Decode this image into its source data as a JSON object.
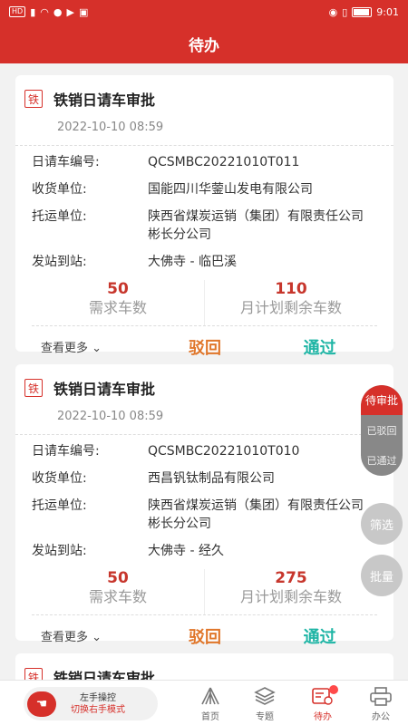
{
  "status": {
    "carrier": "HD",
    "time": "9:01"
  },
  "header": {
    "title": "待办"
  },
  "cards": [
    {
      "badge": "铁",
      "title": "铁销日请车审批",
      "date": "2022-10-10 08:59",
      "fields": [
        {
          "key": "日请车编号:",
          "value": "QCSMBC20221010T011"
        },
        {
          "key": "收货单位:",
          "value": "国能四川华蓥山发电有限公司"
        },
        {
          "key": "托运单位:",
          "value": "陕西省煤炭运销（集团）有限责任公司彬长分公司"
        },
        {
          "key": "发站到站:",
          "value": "大佛寺 - 临巴溪"
        }
      ],
      "demand_num": "50",
      "demand_label": "需求车数",
      "remain_num": "110",
      "remain_label": "月计划剩余车数",
      "more": "查看更多",
      "reject": "驳回",
      "pass": "通过"
    },
    {
      "badge": "铁",
      "title": "铁销日请车审批",
      "date": "2022-10-10 08:59",
      "fields": [
        {
          "key": "日请车编号:",
          "value": "QCSMBC20221010T010"
        },
        {
          "key": "收货单位:",
          "value": "西昌钒钛制品有限公司"
        },
        {
          "key": "托运单位:",
          "value": "陕西省煤炭运销（集团）有限责任公司彬长分公司"
        },
        {
          "key": "发站到站:",
          "value": "大佛寺 - 经久"
        }
      ],
      "demand_num": "50",
      "demand_label": "需求车数",
      "remain_num": "275",
      "remain_label": "月计划剩余车数",
      "more": "查看更多",
      "reject": "驳回",
      "pass": "通过"
    },
    {
      "badge": "铁",
      "title": "铁销日请车审批"
    }
  ],
  "float_tabs": [
    "待审批",
    "已驳回",
    "已通过"
  ],
  "filter_label": "筛选",
  "batch_label": "批量",
  "hand_mode": {
    "title": "左手操控",
    "subtitle": "切换右手模式"
  },
  "nav": [
    {
      "label": "首页",
      "icon": "home-icon"
    },
    {
      "label": "专题",
      "icon": "layers-icon"
    },
    {
      "label": "待办",
      "icon": "todo-icon"
    },
    {
      "label": "办公",
      "icon": "printer-icon"
    }
  ],
  "colors": {
    "primary": "#d6302a",
    "reject": "#e0762a",
    "pass": "#1fb5a5"
  }
}
